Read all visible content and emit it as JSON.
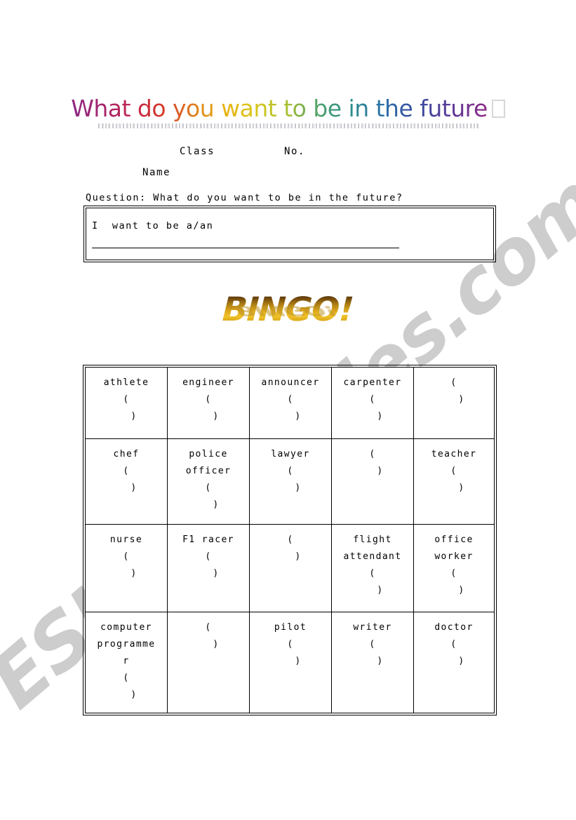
{
  "title": {
    "text": "What do you want to be in the future",
    "trailing_glyph": "missing-glyph-box",
    "style": "rainbow-wordart"
  },
  "header_fields": {
    "class_label": "Class",
    "no_label": "No.",
    "name_label": "Name"
  },
  "question": {
    "text": "Question: What do you want to be in the future?"
  },
  "answer_box": {
    "prompt": "I  want to be a/an",
    "blank_rule": ""
  },
  "bingo_logo": {
    "text": "BINGO!",
    "reflection_text": "BINGO!",
    "color_top": "#3d2408",
    "color_mid": "#d9a41b",
    "color_bottom": "#f0c22a"
  },
  "watermark": {
    "text": "ESLprintables.com",
    "color": "#cdcdcd"
  },
  "grid": {
    "rows": 4,
    "columns": 5,
    "paren_open": "(",
    "paren_close": ")",
    "cells": [
      [
        {
          "job": "athlete"
        },
        {
          "job": "engineer"
        },
        {
          "job": "announcer"
        },
        {
          "job": "carpenter"
        },
        {
          "job": ""
        }
      ],
      [
        {
          "job": "chef"
        },
        {
          "job": "police\nofficer"
        },
        {
          "job": "lawyer"
        },
        {
          "job": ""
        },
        {
          "job": "teacher"
        }
      ],
      [
        {
          "job": "nurse"
        },
        {
          "job": "F1 racer"
        },
        {
          "job": ""
        },
        {
          "job": "flight\nattendant"
        },
        {
          "job": "office\nworker"
        }
      ],
      [
        {
          "job": "computer\nprogramme\nr"
        },
        {
          "job": ""
        },
        {
          "job": "pilot"
        },
        {
          "job": "writer"
        },
        {
          "job": "doctor"
        }
      ]
    ]
  }
}
